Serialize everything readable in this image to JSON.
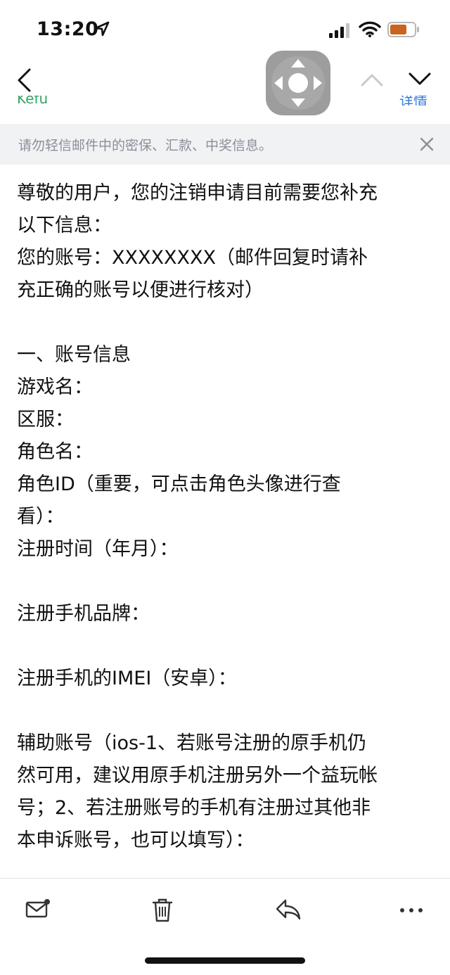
{
  "status_bar": {
    "time": "13:20"
  },
  "nav": {
    "sender_peek": "Kefu",
    "link_peek": "详情"
  },
  "notice": {
    "text": "请勿轻信邮件中的密保、汇款、中奖信息。"
  },
  "email_body": {
    "lines": [
      "尊敬的用户，您的注销申请目前需要您补充",
      "以下信息：",
      "您的账号：XXXXXXXX（邮件回复时请补",
      "充正确的账号以便进行核对）",
      "",
      "一、账号信息",
      "游戏名：",
      "区服：",
      "角色名：",
      "角色ID（重要，可点击角色头像进行查",
      "看）：",
      "注册时间（年月）：",
      "",
      "注册手机品牌：",
      "",
      "注册手机的IMEI（安卓）：",
      "",
      "辅助账号（ios-1、若账号注册的原手机仍",
      "然可用，建议用原手机注册另外一个益玩帐",
      "号；2、若注册账号的手机有注册过其他非",
      "本申诉账号，也可以填写）："
    ]
  },
  "icons": {
    "back": "chevron-left-icon",
    "assist": "assistive-touch-icon",
    "prev": "chevron-up-icon",
    "next": "chevron-down-icon",
    "close": "close-icon",
    "mark_unread": "mail-unread-icon",
    "delete": "trash-icon",
    "reply": "reply-icon",
    "more": "more-icon"
  },
  "colors": {
    "battery": "#c8641e",
    "sender": "#39a36b",
    "link": "#3a7bd5",
    "notice_bg": "#f1f2f4"
  }
}
